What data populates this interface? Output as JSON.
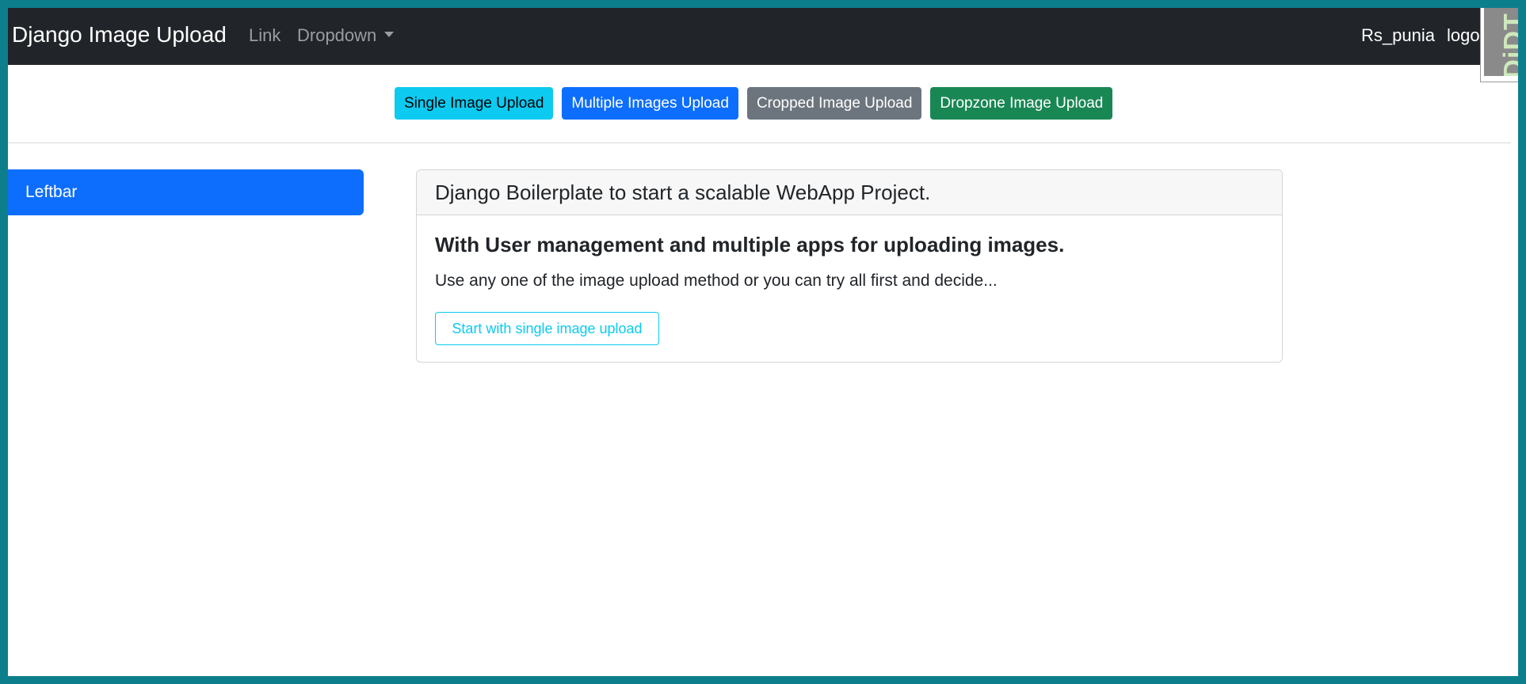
{
  "navbar": {
    "brand": "Django Image Upload",
    "links": [
      "Link",
      "Dropdown"
    ],
    "username": "Rs_punia",
    "logout": "logout"
  },
  "debug_toolbar": {
    "label": "DjDT"
  },
  "upload_buttons": [
    {
      "label": "Single Image Upload",
      "color": "#0dcaf0"
    },
    {
      "label": "Multiple Images Upload",
      "color": "#0d6efd"
    },
    {
      "label": "Cropped Image Upload",
      "color": "#6c757d"
    },
    {
      "label": "Dropzone Image Upload",
      "color": "#198754"
    }
  ],
  "sidebar": {
    "label": "Leftbar",
    "color": "#0d6efd"
  },
  "card": {
    "header": "Django Boilerplate to start a scalable WebApp Project.",
    "title": "With User management and multiple apps for uploading images.",
    "text": "Use any one of the image upload method or you can try all first and decide...",
    "button": "Start with single image upload"
  },
  "colors": {
    "navbar_bg": "#212529",
    "page_bg": "#0d7f8c"
  }
}
